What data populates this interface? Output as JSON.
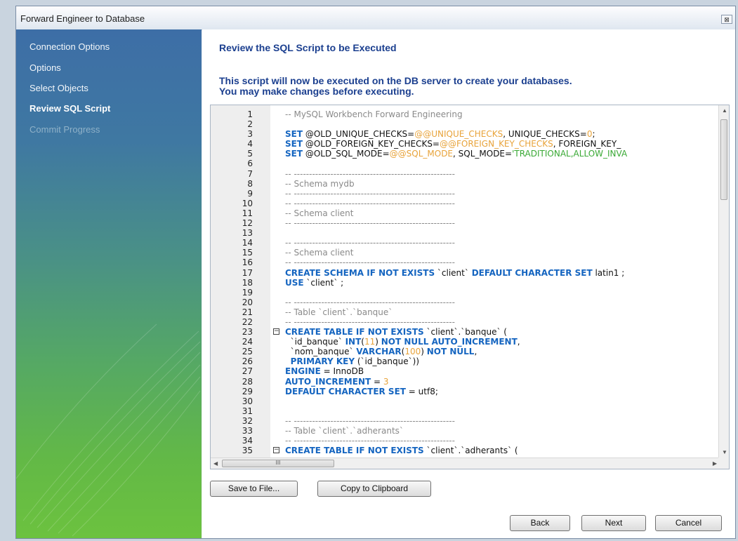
{
  "window": {
    "title": "Forward Engineer to Database",
    "close_glyph": "⊠"
  },
  "sidebar": {
    "steps": [
      {
        "label": "Connection Options",
        "state": "done"
      },
      {
        "label": "Options",
        "state": "done"
      },
      {
        "label": "Select Objects",
        "state": "done"
      },
      {
        "label": "Review SQL Script",
        "state": "active"
      },
      {
        "label": "Commit Progress",
        "state": "pending"
      }
    ]
  },
  "main": {
    "heading": "Review the SQL Script to be Executed",
    "description_line1": "This script will now be executed on the DB server to create your databases.",
    "description_line2": "You may make changes before executing."
  },
  "editor": {
    "lines": [
      {
        "n": "1",
        "html": "<span class=\"c\">-- MySQL Workbench Forward Engineering</span>"
      },
      {
        "n": "2",
        "html": ""
      },
      {
        "n": "3",
        "html": "<span class=\"k\">SET</span> @OLD_UNIQUE_CHECKS=<span class=\"n\">@@UNIQUE_CHECKS</span>, UNIQUE_CHECKS=<span class=\"n\">0</span>;"
      },
      {
        "n": "4",
        "html": "<span class=\"k\">SET</span> @OLD_FOREIGN_KEY_CHECKS=<span class=\"n\">@@FOREIGN_KEY_CHECKS</span>, FOREIGN_KEY_"
      },
      {
        "n": "5",
        "html": "<span class=\"k\">SET</span> @OLD_SQL_MODE=<span class=\"n\">@@SQL_MODE</span>, SQL_MODE=<span class=\"s\">'TRADITIONAL,ALLOW_INVA</span>"
      },
      {
        "n": "6",
        "html": ""
      },
      {
        "n": "7",
        "html": "<span class=\"c\">-- -----------------------------------------------------</span>"
      },
      {
        "n": "8",
        "html": "<span class=\"c\">-- Schema mydb</span>"
      },
      {
        "n": "9",
        "html": "<span class=\"c\">-- -----------------------------------------------------</span>"
      },
      {
        "n": "10",
        "html": "<span class=\"c\">-- -----------------------------------------------------</span>"
      },
      {
        "n": "11",
        "html": "<span class=\"c\">-- Schema client</span>"
      },
      {
        "n": "12",
        "html": "<span class=\"c\">-- -----------------------------------------------------</span>"
      },
      {
        "n": "13",
        "html": ""
      },
      {
        "n": "14",
        "html": "<span class=\"c\">-- -----------------------------------------------------</span>"
      },
      {
        "n": "15",
        "html": "<span class=\"c\">-- Schema client</span>"
      },
      {
        "n": "16",
        "html": "<span class=\"c\">-- -----------------------------------------------------</span>"
      },
      {
        "n": "17",
        "html": "<span class=\"k\">CREATE SCHEMA IF NOT EXISTS</span> `client` <span class=\"k\">DEFAULT CHARACTER SET</span> latin1 ;"
      },
      {
        "n": "18",
        "html": "<span class=\"k\">USE</span> `client` ;"
      },
      {
        "n": "19",
        "html": ""
      },
      {
        "n": "20",
        "html": "<span class=\"c\">-- -----------------------------------------------------</span>"
      },
      {
        "n": "21",
        "html": "<span class=\"c\">-- Table `client`.`banque`</span>"
      },
      {
        "n": "22",
        "html": "<span class=\"c\">-- -----------------------------------------------------</span>"
      },
      {
        "n": "23",
        "fold": "−",
        "html": "<span class=\"k\">CREATE TABLE IF NOT EXISTS</span> `client`.`banque` ("
      },
      {
        "n": "24",
        "html": "  `id_banque` <span class=\"k\">INT</span>(<span class=\"n\">11</span>) <span class=\"k\">NOT NULL AUTO_INCREMENT</span>,"
      },
      {
        "n": "25",
        "html": "  `nom_banque` <span class=\"k\">VARCHAR</span>(<span class=\"n\">100</span>) <span class=\"k\">NOT NULL</span>,"
      },
      {
        "n": "26",
        "html": "  <span class=\"k\">PRIMARY KEY</span> (`id_banque`))"
      },
      {
        "n": "27",
        "html": "<span class=\"k\">ENGINE</span> = InnoDB"
      },
      {
        "n": "28",
        "html": "<span class=\"k\">AUTO_INCREMENT</span> = <span class=\"n\">3</span>"
      },
      {
        "n": "29",
        "html": "<span class=\"k\">DEFAULT CHARACTER SET</span> = utf8;"
      },
      {
        "n": "30",
        "html": ""
      },
      {
        "n": "31",
        "html": ""
      },
      {
        "n": "32",
        "html": "<span class=\"c\">-- -----------------------------------------------------</span>"
      },
      {
        "n": "33",
        "html": "<span class=\"c\">-- Table `client`.`adherants`</span>"
      },
      {
        "n": "34",
        "html": "<span class=\"c\">-- -----------------------------------------------------</span>"
      },
      {
        "n": "35",
        "fold": "−",
        "html": "<span class=\"k\">CREATE TABLE IF NOT EXISTS</span> `client`.`adherants` ("
      }
    ],
    "hscroll_thumb_glyph": "III"
  },
  "buttons": {
    "save_to_file": "Save to File...",
    "copy_to_clipboard": "Copy to Clipboard",
    "back": "Back",
    "next": "Next",
    "cancel": "Cancel"
  }
}
